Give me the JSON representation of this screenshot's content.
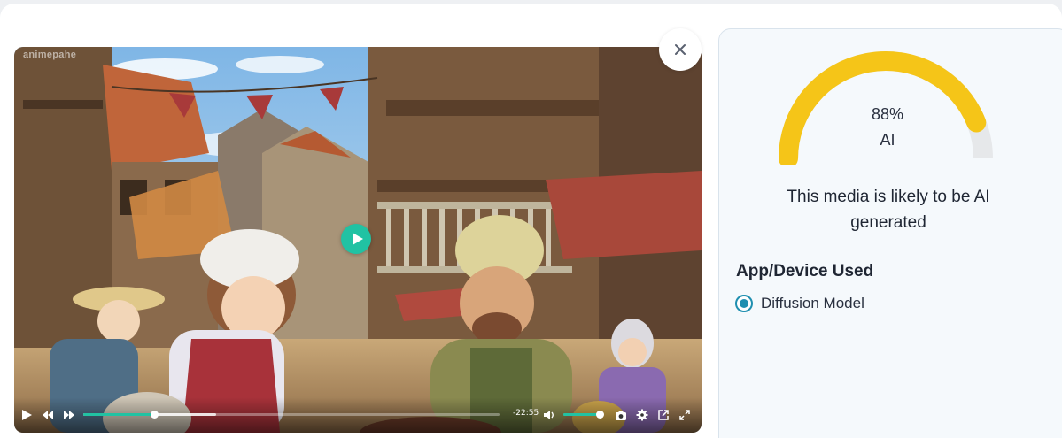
{
  "video": {
    "watermark": "animepahe",
    "time_remaining": "-22:55",
    "progress": 0.17,
    "buffered": 0.32,
    "volume": 0.94
  },
  "result": {
    "score_percent": 88,
    "score_text": "88%",
    "label": "AI",
    "verdict": "This media is likely to be AI generated",
    "section_title": "App/Device Used",
    "options": [
      {
        "label": "Diffusion Model",
        "selected": true
      }
    ],
    "gauge_color": "#f5c518",
    "gauge_track_color": "#e6e8ea"
  },
  "colors": {
    "accent": "#21c2a3",
    "radio": "#1f8fb0"
  },
  "icons": [
    "close-icon",
    "play-icon",
    "rewind-icon",
    "fast-forward-icon",
    "volume-icon",
    "camera-icon",
    "gear-icon",
    "popout-icon",
    "fullscreen-icon"
  ]
}
